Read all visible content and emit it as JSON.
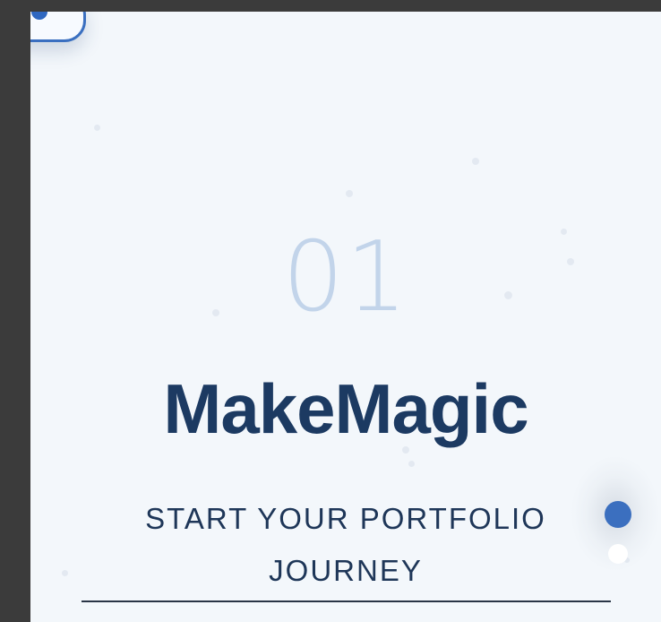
{
  "hero": {
    "step_number": "01",
    "brand": "MakeMagic",
    "tagline_line1": "START YOUR PORTFOLIO",
    "tagline_line2": "JOURNEY"
  },
  "toggle": {
    "state": "on",
    "icon": "toggle-switch-icon"
  },
  "navigation": {
    "total_dots": 2,
    "active_index": 0
  },
  "colors": {
    "accent": "#3b6fbf",
    "title": "#1c3a62",
    "number": "#c2d4ea",
    "background": "#f3f7fb"
  }
}
